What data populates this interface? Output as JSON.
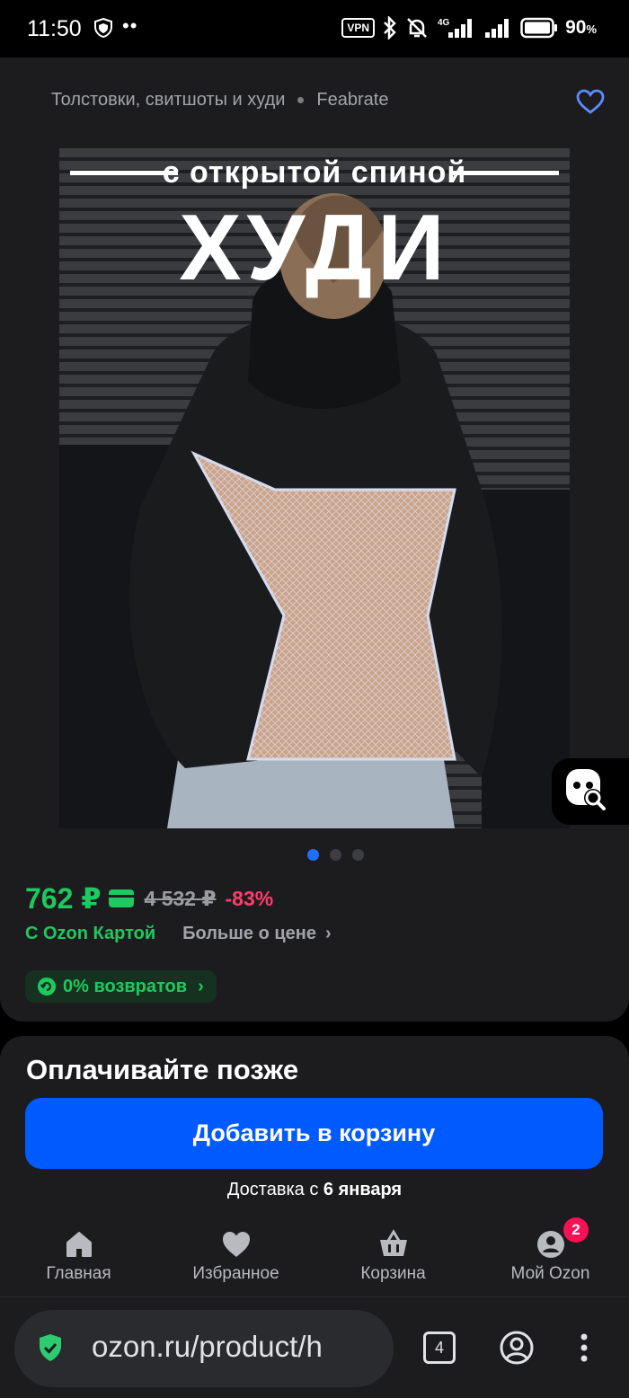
{
  "status_bar": {
    "time": "11:50",
    "dots": "••",
    "vpn": "VPN",
    "network": "4G",
    "battery_percent": "90",
    "battery_unit": "%"
  },
  "product": {
    "breadcrumb": {
      "category": "Толстовки, свитшоты и худи",
      "brand": "Feabrate"
    },
    "image": {
      "caption_small": "с открытой спиной",
      "caption_big": "ХУДИ"
    },
    "carousel": {
      "count": 3,
      "active": 0
    },
    "price": {
      "current": "762 ₽",
      "old": "4 532 ₽",
      "discount": "-83%",
      "card_label": "С Ozon Картой",
      "more_label": "Больше о цене",
      "more_chevron": "›"
    },
    "returns": {
      "label": "0% возвратов",
      "chevron": "›"
    }
  },
  "checkout": {
    "pay_later": "Оплачивайте позже",
    "add_to_cart": "Добавить в корзину",
    "delivery_prefix": "Доставка с",
    "delivery_date": "6 января"
  },
  "bottom_nav": {
    "items": [
      {
        "label": "Главная",
        "icon": "home-icon"
      },
      {
        "label": "Избранное",
        "icon": "heart-icon"
      },
      {
        "label": "Корзина",
        "icon": "basket-icon"
      },
      {
        "label": "Мой Ozon",
        "icon": "profile-icon",
        "badge": "2"
      }
    ]
  },
  "browser": {
    "url": "ozon.ru/product/h",
    "tab_count": "4"
  },
  "colors": {
    "accent_blue": "#005bff",
    "price_green": "#1ec95f",
    "discount_pink": "#ff3c6e",
    "badge_red": "#f91155",
    "card_bg": "#1c1c1e"
  }
}
